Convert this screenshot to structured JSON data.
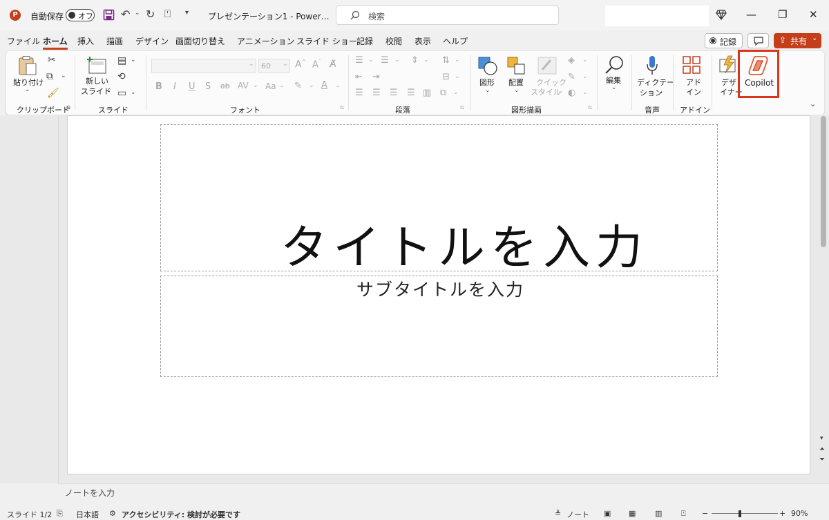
{
  "titlebar": {
    "autosave_label": "自動保存",
    "autosave_state": "オフ",
    "doc_title": "プレゼンテーション1  -  Power…",
    "search_placeholder": "検索"
  },
  "menu_tabs": [
    "ファイル",
    "ホーム",
    "挿入",
    "描画",
    "デザイン",
    "画面切り替え",
    "アニメーション",
    "スライド ショー",
    "記録",
    "校閲",
    "表示",
    "ヘルプ"
  ],
  "active_tab": "ホーム",
  "top_right": {
    "record_label": "記録",
    "share_label": "共有"
  },
  "ribbon": {
    "clipboard": {
      "paste_label": "貼り付け",
      "group_label": "クリップボード"
    },
    "slides": {
      "new_slide_line1": "新しい",
      "new_slide_line2": "スライド",
      "group_label": "スライド"
    },
    "font": {
      "size_value": "60",
      "group_label": "フォント",
      "bold": "B",
      "italic": "I",
      "underline": "U",
      "shadow": "S",
      "strike": "ab",
      "spacing": "AV",
      "case": "Aa"
    },
    "paragraph": {
      "group_label": "段落"
    },
    "drawing": {
      "shapes_label": "図形",
      "arrange_label": "配置",
      "quick_style_line1": "クイック",
      "quick_style_line2": "スタイル",
      "group_label": "図形描画"
    },
    "editing": {
      "label": "編集"
    },
    "voice": {
      "dictate_line1": "ディクテー",
      "dictate_line2": "ション",
      "group_label": "音声"
    },
    "addins": {
      "label_line1": "アド",
      "label_line2": "イン",
      "group_label": "アドイン"
    },
    "designer": {
      "label_line1": "デザ",
      "label_line2": "イナー"
    },
    "copilot": {
      "label": "Copilot"
    }
  },
  "slide": {
    "title_placeholder": "タイトルを入力",
    "subtitle_placeholder": "サブタイトルを入力"
  },
  "notes": {
    "placeholder": "ノートを入力"
  },
  "statusbar": {
    "slide_count": "スライド 1/2",
    "language": "日本語",
    "accessibility": "アクセシビリティ: 検討が必要です",
    "notes_label": "ノート",
    "zoom": "90%"
  },
  "colors": {
    "brand": "#c43e1c",
    "copilot_highlight": "#d9361b"
  }
}
